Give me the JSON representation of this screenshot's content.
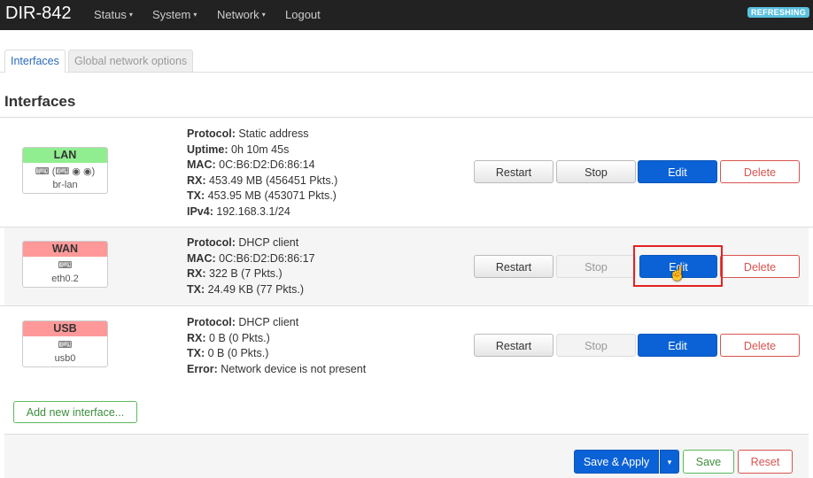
{
  "app": {
    "brand": "DIR-842",
    "status_badge": "REFRESHING"
  },
  "nav": [
    {
      "label": "Status",
      "caret": "▾"
    },
    {
      "label": "System",
      "caret": "▾"
    },
    {
      "label": "Network",
      "caret": "▾"
    },
    {
      "label": "Logout",
      "caret": ""
    }
  ],
  "tabs": [
    {
      "label": "Interfaces",
      "active": true
    },
    {
      "label": "Global network options",
      "active": false
    }
  ],
  "section_title": "Interfaces",
  "interfaces": [
    {
      "name": "LAN",
      "color": "#90ee90",
      "device": "br-lan",
      "icons": "⌨ (⌨ ◉ ◉)",
      "info": [
        {
          "k": "Protocol:",
          "v": "Static address"
        },
        {
          "k": "Uptime:",
          "v": "0h 10m 45s"
        },
        {
          "k": "MAC:",
          "v": "0C:B6:D2:D6:86:14"
        },
        {
          "k": "RX:",
          "v": "453.49 MB (456451 Pkts.)"
        },
        {
          "k": "TX:",
          "v": "453.95 MB (453071 Pkts.)"
        },
        {
          "k": "IPv4:",
          "v": "192.168.3.1/24"
        }
      ],
      "buttons": {
        "restart": "Restart",
        "stop": "Stop",
        "edit": "Edit",
        "delete": "Delete"
      }
    },
    {
      "name": "WAN",
      "color": "#ff9999",
      "device": "eth0.2",
      "icons": "⌨",
      "info": [
        {
          "k": "Protocol:",
          "v": "DHCP client"
        },
        {
          "k": "MAC:",
          "v": "0C:B6:D2:D6:86:17"
        },
        {
          "k": "RX:",
          "v": "322 B (7 Pkts.)"
        },
        {
          "k": "TX:",
          "v": "24.49 KB (77 Pkts.)"
        }
      ],
      "buttons": {
        "restart": "Restart",
        "stop": "Stop",
        "edit": "Edit",
        "delete": "Delete"
      }
    },
    {
      "name": "USB",
      "color": "#ff9999",
      "device": "usb0",
      "icons": "⌨",
      "info": [
        {
          "k": "Protocol:",
          "v": "DHCP client"
        },
        {
          "k": "RX:",
          "v": "0 B (0 Pkts.)"
        },
        {
          "k": "TX:",
          "v": "0 B (0 Pkts.)"
        },
        {
          "k": "Error:",
          "v": "Network device is not present"
        }
      ],
      "buttons": {
        "restart": "Restart",
        "stop": "Stop",
        "edit": "Edit",
        "delete": "Delete"
      }
    }
  ],
  "add_interface_label": "Add new interface...",
  "footer": {
    "save_apply": "Save & Apply",
    "dropdown_caret": "▾",
    "save": "Save",
    "reset": "Reset"
  }
}
